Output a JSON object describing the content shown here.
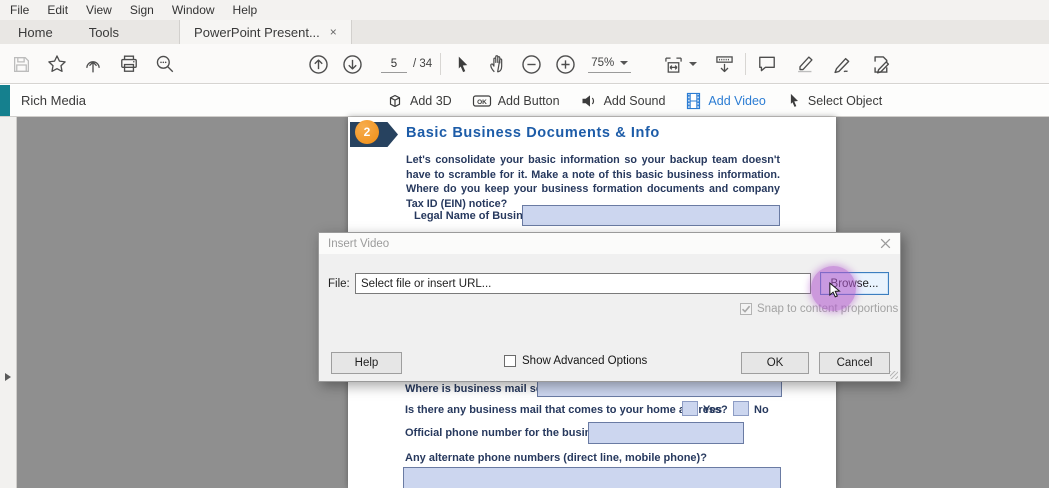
{
  "menu_bar": {
    "items": [
      "File",
      "Edit",
      "View",
      "Sign",
      "Window",
      "Help"
    ]
  },
  "tab_bar": {
    "home": "Home",
    "tools": "Tools",
    "doc_tab": "PowerPoint Present...",
    "close_glyph": "×"
  },
  "toolbar": {
    "page_current": "5",
    "page_total": "/ 34",
    "zoom_level": "75%"
  },
  "rich_media": {
    "title": "Rich Media",
    "ok_icon_text": "OK",
    "buttons": [
      "Add 3D",
      "Add Button",
      "Add Sound",
      "Add Video",
      "Select Object"
    ]
  },
  "document": {
    "section_number": "2",
    "heading": "Basic Business Documents & Info",
    "paragraph": "Let's consolidate your basic information so your backup team doesn't have to scramble for it. Make a note of this basic business information. Where do you keep your business formation documents and company Tax ID (EIN) notice?",
    "legal_name_label": "Legal Name of Business:",
    "mail_sent_label": "Where is business mail sent?",
    "home_address_question": "Is there any business mail that comes to your home address?",
    "yes_label": "Yes",
    "no_label": "No",
    "phone_label": "Official phone number for the business:",
    "alt_phone_label": "Any alternate phone numbers (direct line, mobile phone)?"
  },
  "dialog": {
    "title": "Insert Video",
    "file_label": "File:",
    "file_placeholder": "Select file or insert URL...",
    "browse_label": "Browse...",
    "snap_label": "Snap to content proportions",
    "help_label": "Help",
    "advanced_label": "Show Advanced Options",
    "ok_label": "OK",
    "cancel_label": "Cancel"
  },
  "colors": {
    "accent_teal": "#15808E",
    "active_blue": "#2B7CD3",
    "heading_blue": "#1D5CA8",
    "body_navy": "#27395E",
    "field_fill": "#CCD6EF",
    "badge_orange": "#EF8D14",
    "banner_navy": "#27425F",
    "highlight_purple": "#B25ACD"
  }
}
